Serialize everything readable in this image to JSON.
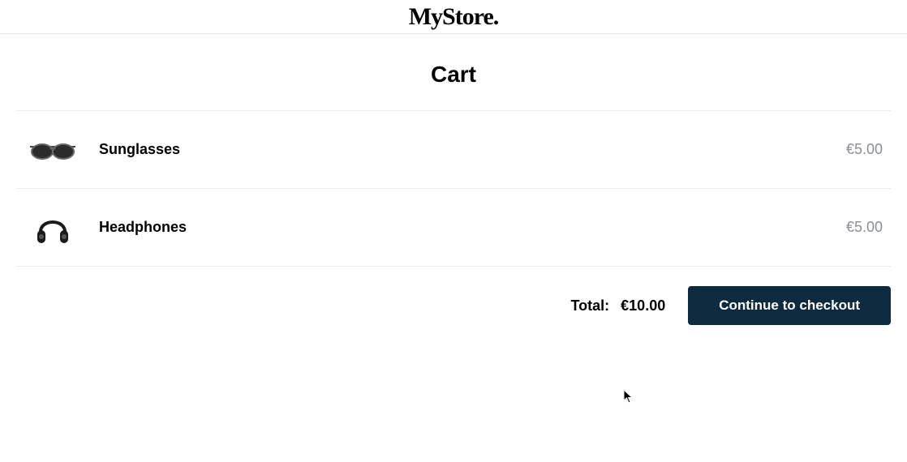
{
  "header": {
    "logo_text": "MyStore."
  },
  "page": {
    "title": "Cart"
  },
  "cart": {
    "items": [
      {
        "name": "Sunglasses",
        "price": "€5.00",
        "icon": "sunglasses"
      },
      {
        "name": "Headphones",
        "price": "€5.00",
        "icon": "headphones"
      }
    ],
    "total_label": "Total:",
    "total_value": "€10.00",
    "checkout_label": "Continue to checkout"
  }
}
